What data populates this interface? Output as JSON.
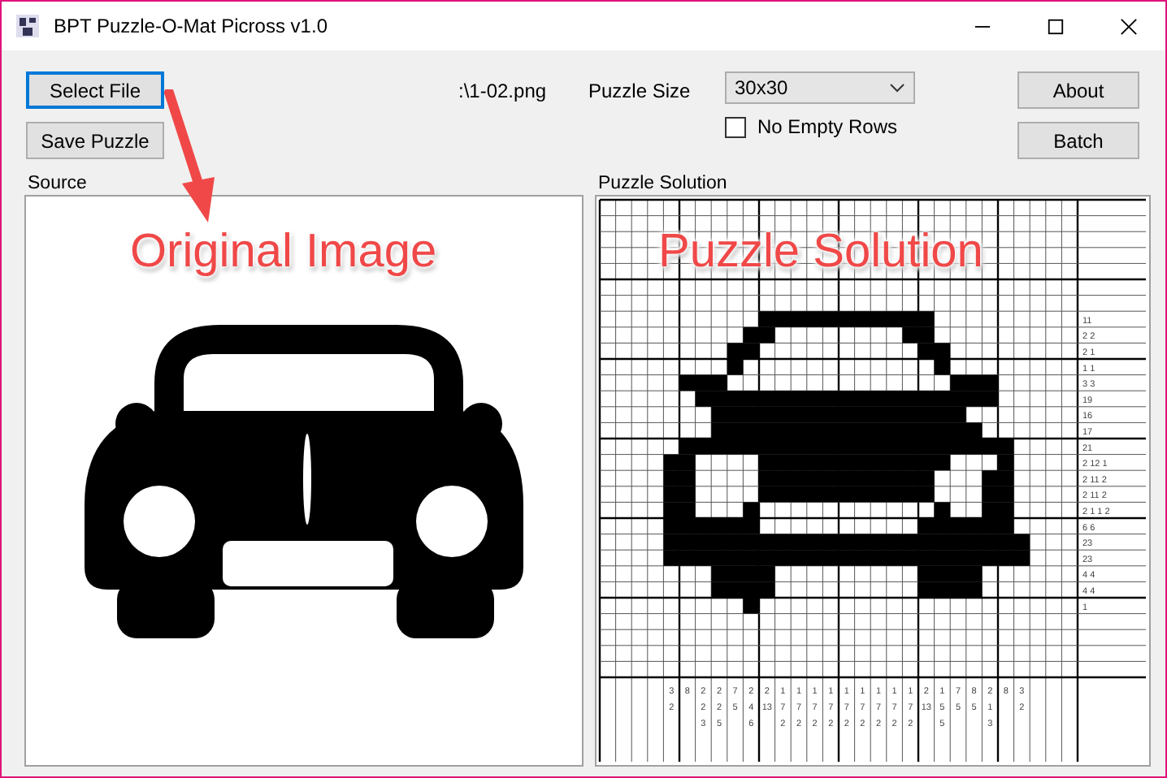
{
  "window": {
    "title": "BPT Puzzle-O-Mat Picross v1.0"
  },
  "toolbar": {
    "select_file": "Select File",
    "save_puzzle": "Save Puzzle",
    "file_name": ":\\1-02.png",
    "puzzle_size_label": "Puzzle Size",
    "puzzle_size": "30x30",
    "no_empty_rows": {
      "label": "No Empty Rows",
      "checked": false
    },
    "about": "About",
    "batch": "Batch"
  },
  "source": {
    "label": "Source",
    "annotation": "Original Image"
  },
  "solution": {
    "label": "Puzzle Solution",
    "annotation": "Puzzle Solution",
    "row_clues": [
      "11",
      "2 2",
      "2 1",
      "1 1",
      "3 3",
      "19",
      "16",
      "17",
      "21",
      "2 12 1",
      "2 11 2",
      "2 11 2",
      "2 1 1 2",
      "6 6",
      "23",
      "23",
      "4 4",
      "4 4",
      "1"
    ],
    "column_clues": [
      [
        "3",
        "2"
      ],
      [
        "8"
      ],
      [
        "2",
        "2",
        "3"
      ],
      [
        "2",
        "2",
        "5"
      ],
      [
        "7",
        "5"
      ],
      [
        "2",
        "4",
        "6"
      ],
      [
        "2",
        "13"
      ],
      [
        "1",
        "7",
        "2"
      ],
      [
        "1",
        "7",
        "2"
      ],
      [
        "1",
        "7",
        "2"
      ],
      [
        "1",
        "7",
        "2"
      ],
      [
        "1",
        "7",
        "2"
      ],
      [
        "1",
        "7",
        "2"
      ],
      [
        "1",
        "7",
        "2"
      ],
      [
        "1",
        "7",
        "2"
      ],
      [
        "1",
        "7",
        "2"
      ],
      [
        "2",
        "13"
      ],
      [
        "1",
        "5",
        "5"
      ],
      [
        "7",
        "5"
      ],
      [
        "8",
        "5"
      ],
      [
        "2",
        "1",
        "3"
      ],
      [
        "8"
      ],
      [
        "3",
        "2"
      ]
    ]
  }
}
